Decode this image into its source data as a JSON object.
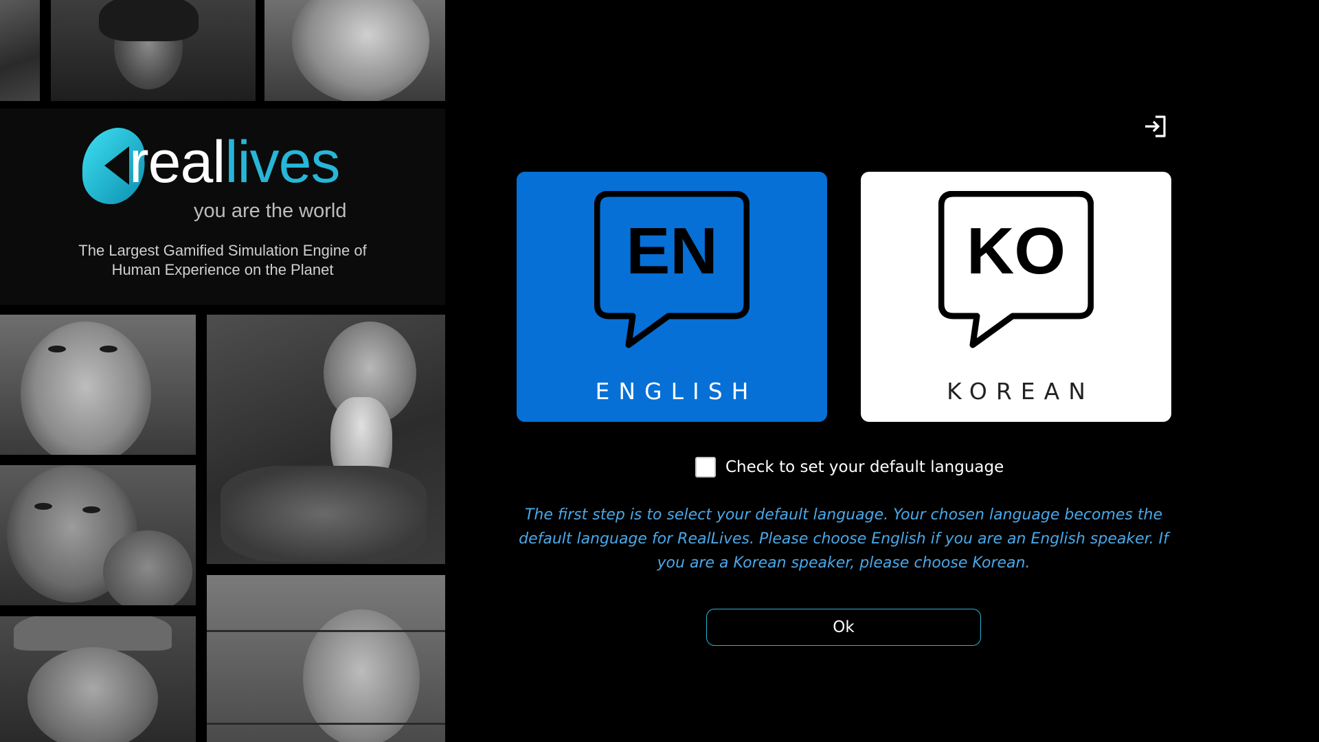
{
  "brand": {
    "name_part1": "real",
    "name_part2": "lives",
    "tagline": "you are the world",
    "description": "The Largest Gamified Simulation Engine of\nHuman Experience on the Planet",
    "accent_color": "#27b6d8"
  },
  "header": {
    "exit_icon": "sign-in-icon"
  },
  "languages": [
    {
      "code": "EN",
      "label": "ENGLISH",
      "selected": true,
      "color": "#0670d7"
    },
    {
      "code": "KO",
      "label": "KOREAN",
      "selected": false,
      "color": "#ffffff"
    }
  ],
  "default_checkbox": {
    "label": "Check to set your default language",
    "checked": false
  },
  "info_text": "The first step is to select your default language. Your chosen language becomes the default language for RealLives. Please choose English if you are an English speaker. If you are a Korean speaker, please choose Korean.",
  "ok_button": {
    "label": "Ok",
    "border_color": "#2bb6d4"
  },
  "colors": {
    "info_text": "#4aa8e8",
    "background": "#000000"
  }
}
